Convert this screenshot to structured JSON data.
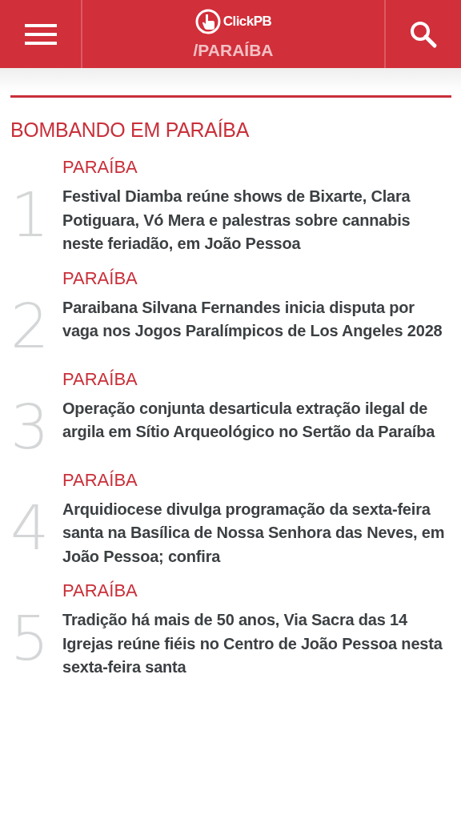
{
  "header": {
    "logo_text": "ClickPB",
    "section": "/PARAÍBA"
  },
  "section_title": "BOMBANDO EM PARAÍBA",
  "articles": [
    {
      "rank": "1",
      "category": "PARAÍBA",
      "title": "Festival Diamba reúne shows de Bixarte, Clara Potiguara, Vó Mera e palestras sobre cannabis neste feriadão, em João Pessoa"
    },
    {
      "rank": "2",
      "category": "PARAÍBA",
      "title": "Paraibana Silvana Fernandes inicia disputa por vaga nos Jogos Paralímpicos de Los Angeles 2028"
    },
    {
      "rank": "3",
      "category": "PARAÍBA",
      "title": "Operação conjunta desarticula extração ilegal de argila em Sítio Arqueológico no Sertão da Paraíba"
    },
    {
      "rank": "4",
      "category": "PARAÍBA",
      "title": "Arquidiocese divulga programação da sexta-feira santa na Basílica de Nossa Senhora das Neves, em João Pessoa; confira"
    },
    {
      "rank": "5",
      "category": "PARAÍBA",
      "title": "Tradição há mais de 50 anos, Via Sacra das 14 Igrejas reúne fiéis no Centro de João Pessoa nesta sexta-feira santa"
    }
  ]
}
